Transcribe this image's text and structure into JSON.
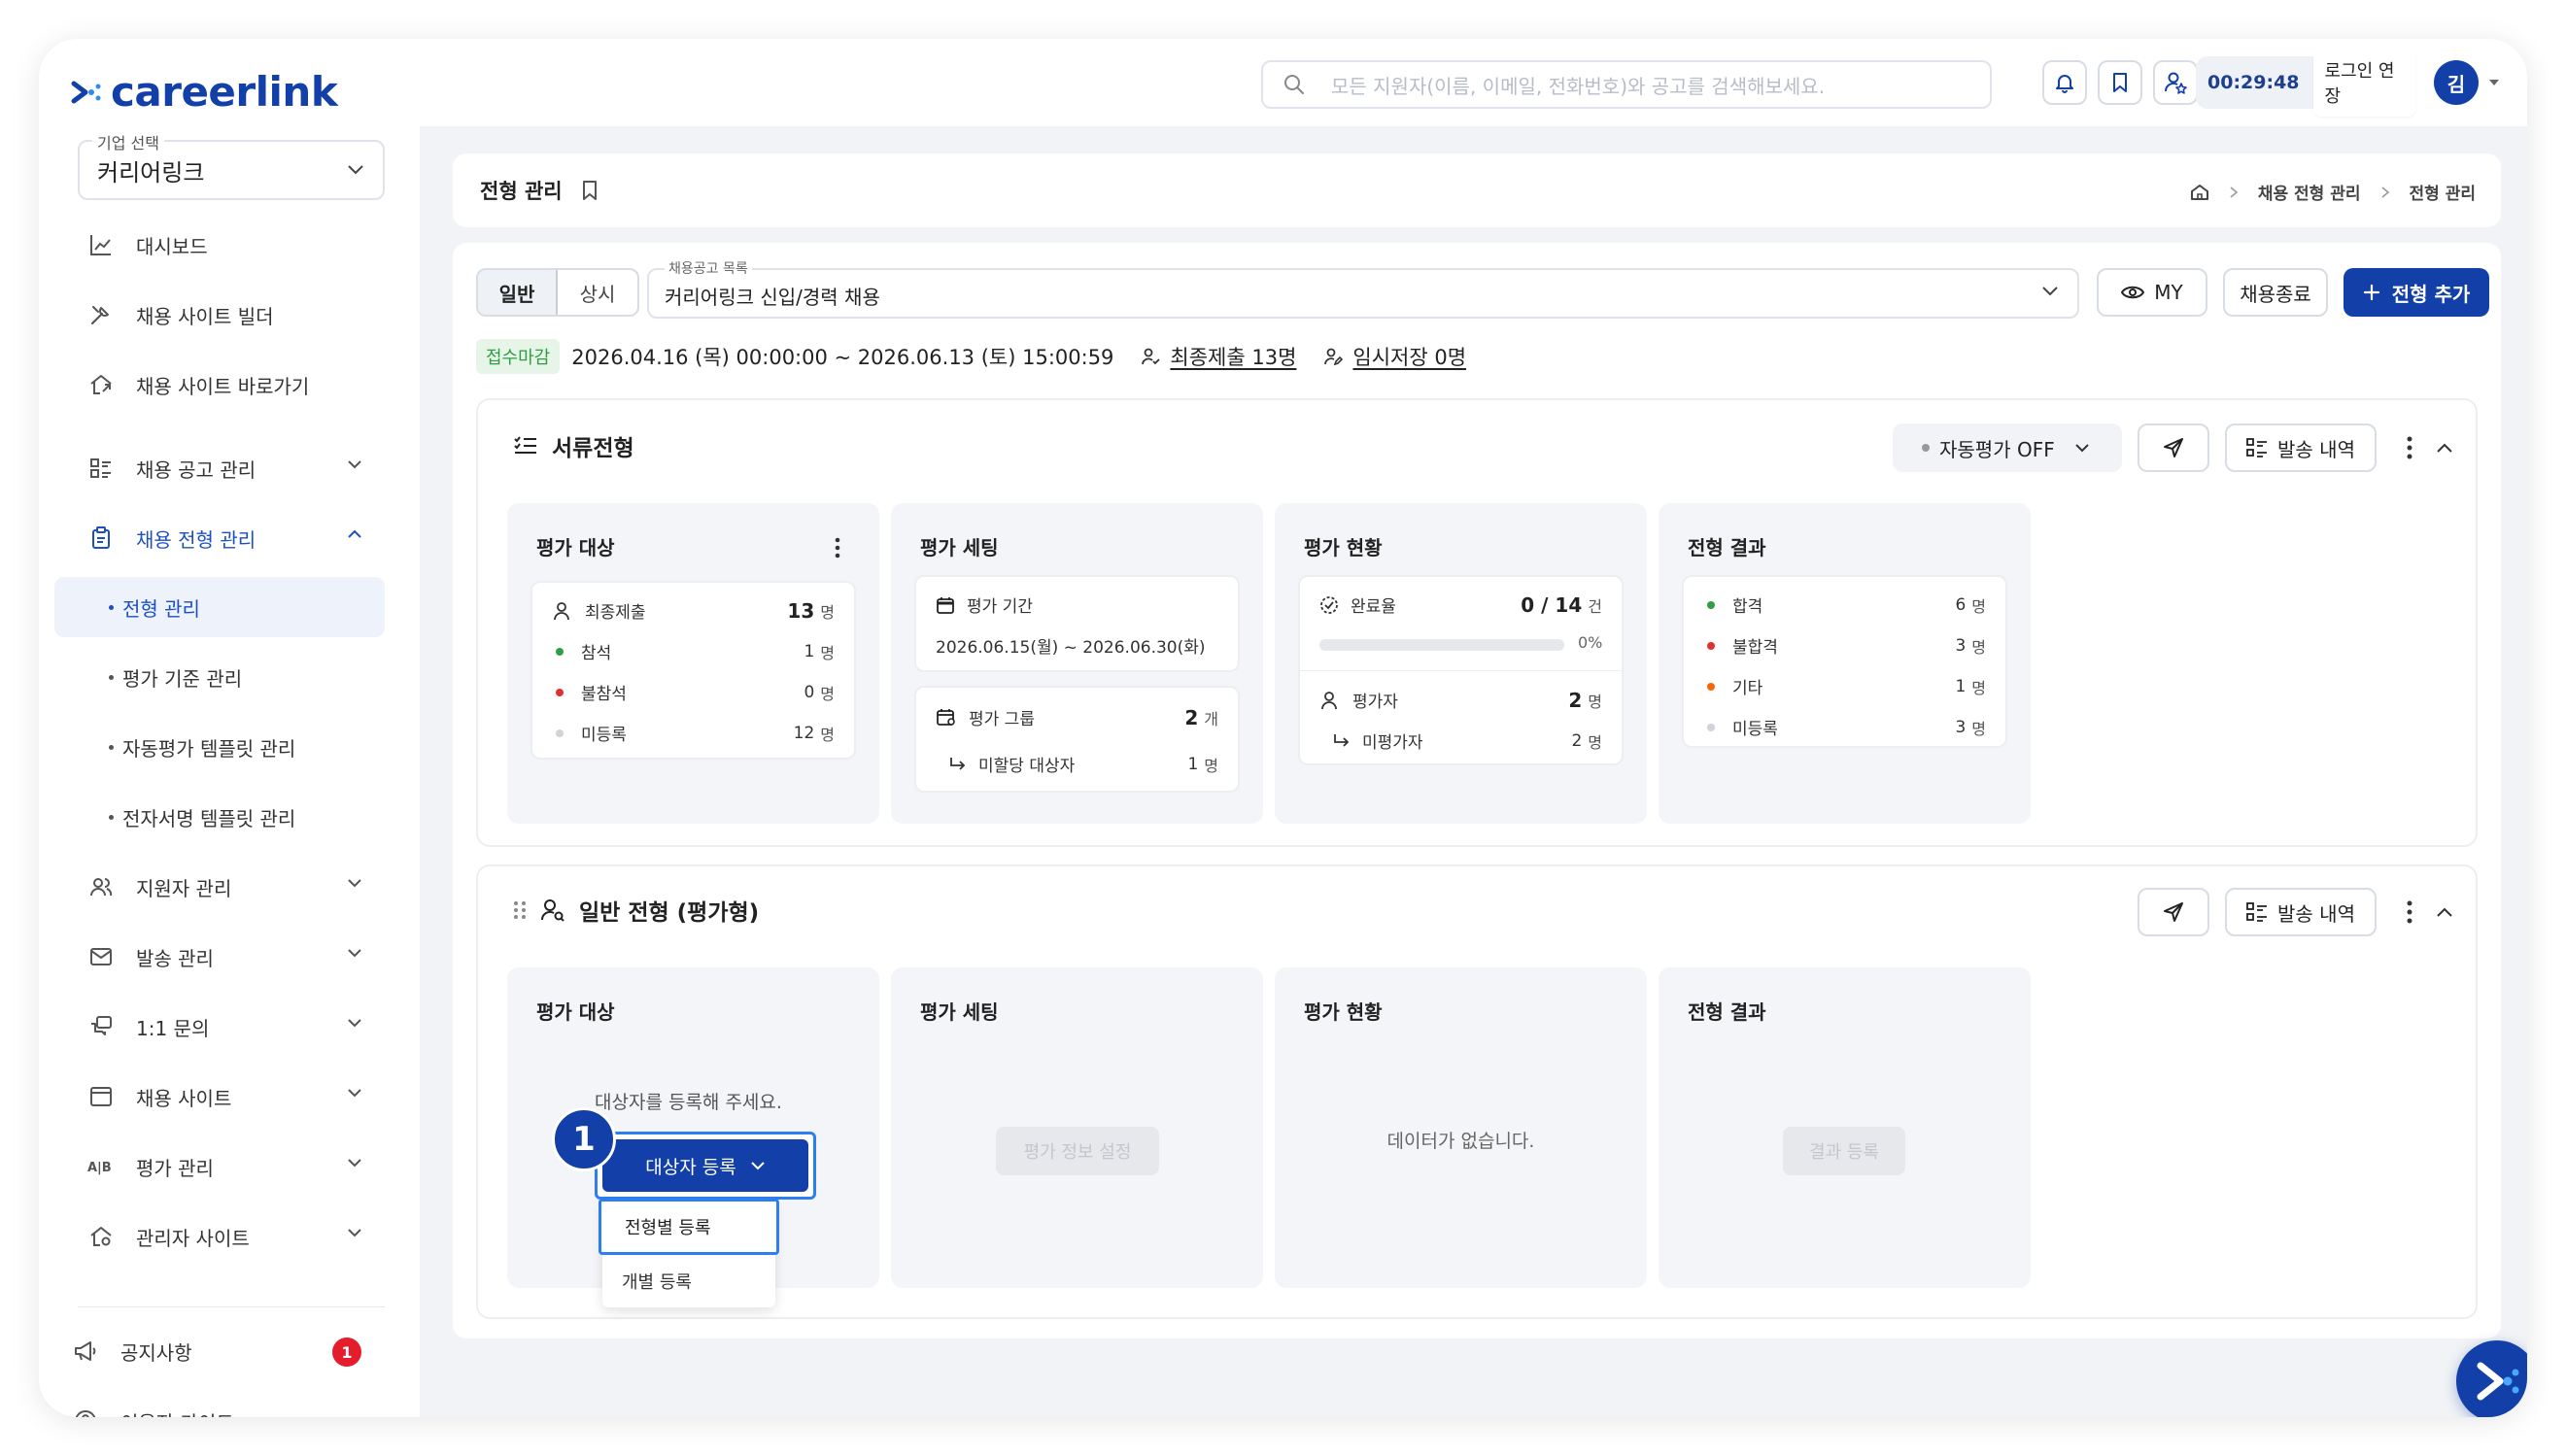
{
  "brand": {
    "name": "careerlink"
  },
  "topbar": {
    "search_placeholder": "모든 지원자(이름, 이메일, 전화번호)와 공고를 검색해보세요.",
    "timer": "00:29:48",
    "extend_label": "로그인 연장",
    "avatar_initial": "김"
  },
  "sidebar": {
    "company_label": "기업 선택",
    "company_value": "커리어링크",
    "items": [
      {
        "label": "대시보드"
      },
      {
        "label": "채용 사이트 빌더"
      },
      {
        "label": "채용 사이트 바로가기"
      },
      {
        "label": "채용 공고 관리"
      },
      {
        "label": "채용 전형 관리"
      },
      {
        "label": "지원자 관리"
      },
      {
        "label": "발송 관리"
      },
      {
        "label": "1:1 문의"
      },
      {
        "label": "채용 사이트"
      },
      {
        "label": "평가 관리"
      },
      {
        "label": "관리자 사이트"
      }
    ],
    "subitems": [
      {
        "label": "전형 관리"
      },
      {
        "label": "평가 기준 관리"
      },
      {
        "label": "자동평가 템플릿 관리"
      },
      {
        "label": "전자서명 템플릿 관리"
      }
    ],
    "notice": {
      "label": "공지사항",
      "badge": "1"
    },
    "guide": {
      "label": "이용자 가이드"
    }
  },
  "page": {
    "title": "전형 관리",
    "breadcrumb": [
      "채용 전형 관리",
      "전형 관리"
    ]
  },
  "toolbar": {
    "tab_general": "일반",
    "tab_always": "상시",
    "posting_label": "채용공고 목록",
    "posting_value": "커리어링크 신입/경력 채용",
    "my_label": "MY",
    "close_label": "채용종료",
    "add_label": "전형 추가"
  },
  "info": {
    "status": "접수마감",
    "period": "2026.04.16 (목) 00:00:00 ~ 2026.06.13 (토) 15:00:59",
    "final_submit": "최종제출 13명",
    "temp_save": "임시저장 0명"
  },
  "colors": {
    "accent": "#1240a8",
    "pass": "#2f9e44",
    "fail": "#e03131",
    "other": "#f76707",
    "none": "#ced4da"
  },
  "stage1": {
    "title": "서류전형",
    "auto_eval": "자동평가 OFF",
    "send_history": "발송 내역",
    "target": {
      "title": "평가 대상",
      "final_label": "최종제출",
      "final_value": "13",
      "final_unit": "명",
      "present_label": "참석",
      "present_value": "1",
      "present_unit": "명",
      "absent_label": "불참석",
      "absent_value": "0",
      "absent_unit": "명",
      "unreg_label": "미등록",
      "unreg_value": "12",
      "unreg_unit": "명"
    },
    "setting": {
      "title": "평가 세팅",
      "period_label": "평가 기간",
      "period_value": "2026.06.15(월) ~ 2026.06.30(화)",
      "group_label": "평가 그룹",
      "group_value": "2",
      "group_unit": "개",
      "unassigned_label": "미할당 대상자",
      "unassigned_value": "1",
      "unassigned_unit": "명"
    },
    "status": {
      "title": "평가 현황",
      "rate_label": "완료율",
      "rate_value": "0 / 14",
      "rate_unit": "건",
      "rate_pct": "0%",
      "evaluator_label": "평가자",
      "evaluator_value": "2",
      "evaluator_unit": "명",
      "unevaluated_label": "미평가자",
      "unevaluated_value": "2",
      "unevaluated_unit": "명"
    },
    "result": {
      "title": "전형 결과",
      "pass_label": "합격",
      "pass_value": "6",
      "pass_unit": "명",
      "fail_label": "불합격",
      "fail_value": "3",
      "fail_unit": "명",
      "other_label": "기타",
      "other_value": "1",
      "other_unit": "명",
      "unreg_label": "미등록",
      "unreg_value": "3",
      "unreg_unit": "명"
    }
  },
  "stage2": {
    "title": "일반 전형 (평가형)",
    "send_history": "발송 내역",
    "target_title": "평가 대상",
    "target_msg": "대상자를 등록해 주세요.",
    "register_btn": "대상자 등록",
    "step_badge": "1",
    "dropdown": [
      "전형별 등록",
      "개별 등록"
    ],
    "setting_title": "평가 세팅",
    "setting_btn": "평가 정보 설정",
    "status_title": "평가 현황",
    "status_empty": "데이터가 없습니다.",
    "result_title": "전형 결과",
    "result_btn": "결과 등록"
  }
}
